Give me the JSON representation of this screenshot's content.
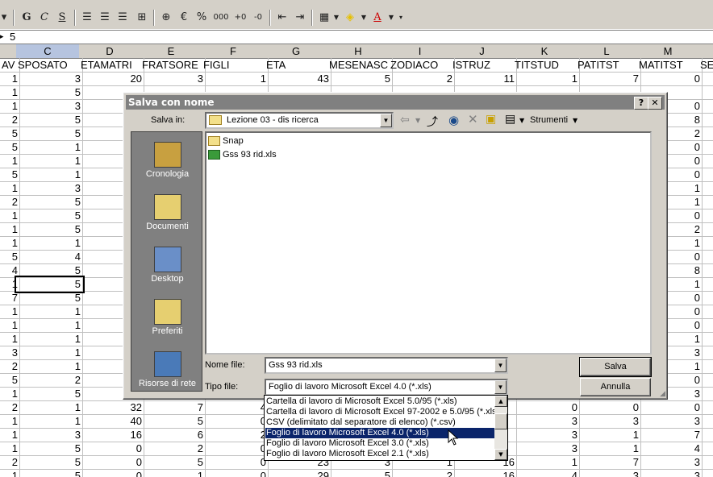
{
  "formula": {
    "name_box": "",
    "value": "5"
  },
  "columns": [
    {
      "id": "C",
      "header": "SPOSATO"
    },
    {
      "id": "D",
      "header": "ETAMATRI"
    },
    {
      "id": "E",
      "header": "FRATSORE"
    },
    {
      "id": "F",
      "header": "FIGLI"
    },
    {
      "id": "G",
      "header": "ETA"
    },
    {
      "id": "H",
      "header": "MESENASC"
    },
    {
      "id": "I",
      "header": "ZODIACO"
    },
    {
      "id": "J",
      "header": "ISTRUZ"
    },
    {
      "id": "K",
      "header": "TITSTUD"
    },
    {
      "id": "L",
      "header": "PATITST"
    },
    {
      "id": "M",
      "header": "MATITST"
    }
  ],
  "edge_headers": {
    "left": "AV",
    "right": "SE"
  },
  "rows": [
    [
      "1",
      "3",
      "20",
      "3",
      "1",
      "43",
      "5",
      "2",
      "11",
      "1",
      "7",
      "0"
    ],
    [
      "1",
      "5",
      "",
      "",
      "",
      "",
      "",
      "",
      "",
      "",
      "",
      ""
    ],
    [
      "1",
      "3",
      "",
      "",
      "",
      "",
      "",
      "",
      "",
      "",
      "",
      "0"
    ],
    [
      "2",
      "5",
      "",
      "",
      "",
      "",
      "",
      "",
      "",
      "",
      "",
      "8"
    ],
    [
      "5",
      "5",
      "",
      "",
      "",
      "",
      "",
      "",
      "",
      "",
      "",
      "2"
    ],
    [
      "5",
      "1",
      "",
      "",
      "",
      "",
      "",
      "",
      "",
      "",
      "",
      "0"
    ],
    [
      "1",
      "1",
      "",
      "",
      "",
      "",
      "",
      "",
      "",
      "",
      "",
      "0"
    ],
    [
      "5",
      "1",
      "",
      "",
      "",
      "",
      "",
      "",
      "",
      "",
      "",
      "0"
    ],
    [
      "1",
      "3",
      "",
      "",
      "",
      "",
      "",
      "",
      "",
      "",
      "",
      "1"
    ],
    [
      "2",
      "5",
      "",
      "",
      "",
      "",
      "",
      "",
      "",
      "",
      "",
      "1"
    ],
    [
      "1",
      "5",
      "",
      "",
      "",
      "",
      "",
      "",
      "",
      "",
      "",
      "0"
    ],
    [
      "1",
      "5",
      "",
      "",
      "",
      "",
      "",
      "",
      "",
      "",
      "",
      "2"
    ],
    [
      "1",
      "1",
      "",
      "",
      "",
      "",
      "",
      "",
      "",
      "",
      "",
      "1"
    ],
    [
      "5",
      "4",
      "",
      "",
      "",
      "",
      "",
      "",
      "",
      "",
      "",
      "0"
    ],
    [
      "4",
      "5",
      "",
      "",
      "",
      "",
      "",
      "",
      "",
      "",
      "",
      "8"
    ],
    [
      "1",
      "5",
      "",
      "",
      "",
      "",
      "",
      "",
      "",
      "",
      "",
      "1"
    ],
    [
      "7",
      "5",
      "",
      "",
      "",
      "",
      "",
      "",
      "",
      "",
      "",
      "0"
    ],
    [
      "1",
      "1",
      "",
      "",
      "",
      "",
      "",
      "",
      "",
      "",
      "",
      "0"
    ],
    [
      "1",
      "1",
      "",
      "",
      "",
      "",
      "",
      "",
      "",
      "",
      "",
      "0"
    ],
    [
      "1",
      "1",
      "",
      "",
      "",
      "",
      "",
      "",
      "",
      "",
      "",
      "1"
    ],
    [
      "3",
      "1",
      "",
      "",
      "",
      "",
      "",
      "",
      "",
      "",
      "",
      "3"
    ],
    [
      "2",
      "1",
      "",
      "",
      "",
      "",
      "",
      "",
      "",
      "",
      "",
      "1"
    ],
    [
      "5",
      "2",
      "",
      "",
      "",
      "",
      "",
      "",
      "",
      "",
      "",
      "0"
    ],
    [
      "1",
      "5",
      "",
      "",
      "",
      "",
      "",
      "",
      "",
      "",
      "",
      "3"
    ],
    [
      "2",
      "1",
      "32",
      "7",
      "4",
      "",
      "",
      "",
      "",
      "0",
      "0",
      "0"
    ],
    [
      "1",
      "1",
      "40",
      "5",
      "0",
      "",
      "",
      "",
      "",
      "3",
      "3",
      "3"
    ],
    [
      "1",
      "3",
      "16",
      "6",
      "2",
      "",
      "",
      "",
      "",
      "3",
      "1",
      "7"
    ],
    [
      "1",
      "5",
      "0",
      "2",
      "0",
      "",
      "",
      "",
      "",
      "3",
      "1",
      "4"
    ],
    [
      "2",
      "5",
      "0",
      "5",
      "0",
      "23",
      "3",
      "1",
      "16",
      "1",
      "7",
      "3"
    ],
    [
      "1",
      "5",
      "0",
      "1",
      "0",
      "29",
      "5",
      "2",
      "16",
      "4",
      "3",
      "3"
    ]
  ],
  "dialog": {
    "title": "Salva con nome",
    "help": "?",
    "close": "✕",
    "save_in_label": "Salva in:",
    "save_in_value": "Lezione 03 - dis ricerca",
    "tools_label": "Strumenti",
    "places": [
      {
        "name": "history",
        "label": "Cronologia",
        "icon": "history-icon"
      },
      {
        "name": "documents",
        "label": "Documenti",
        "icon": "documents-folder-icon"
      },
      {
        "name": "desktop",
        "label": "Desktop",
        "icon": "desktop-icon"
      },
      {
        "name": "favorites",
        "label": "Preferiti",
        "icon": "favorites-folder-icon"
      },
      {
        "name": "network",
        "label": "Risorse di rete",
        "icon": "network-places-icon"
      }
    ],
    "files": [
      {
        "name": "Snap",
        "kind": "folder"
      },
      {
        "name": "Gss 93 rid.xls",
        "kind": "excel"
      }
    ],
    "filename_label": "Nome file:",
    "filename_value": "Gss 93 rid.xls",
    "filetype_label": "Tipo file:",
    "filetype_value": "Foglio di lavoro Microsoft Excel 4.0 (*.xls)",
    "save_button": "Salva",
    "cancel_button": "Annulla",
    "filetype_options": [
      "Cartella di lavoro di Microsoft Excel 5.0/95 (*.xls)",
      "Cartella di lavoro di Microsoft Excel 97-2002 e 5.0/95 (*.xls)",
      "CSV (delimitato dal separatore di elenco) (*.csv)",
      "Foglio di lavoro Microsoft Excel 4.0 (*.xls)",
      "Foglio di lavoro Microsoft Excel 3.0 (*.xls)",
      "Foglio di lavoro Microsoft Excel 2.1 (*.xls)"
    ],
    "selected_option_index": 3
  },
  "toolbar": {
    "bold": "G",
    "italic": "C",
    "underline": "S",
    "euro": "€",
    "percent": "%",
    "thousands": "000"
  }
}
